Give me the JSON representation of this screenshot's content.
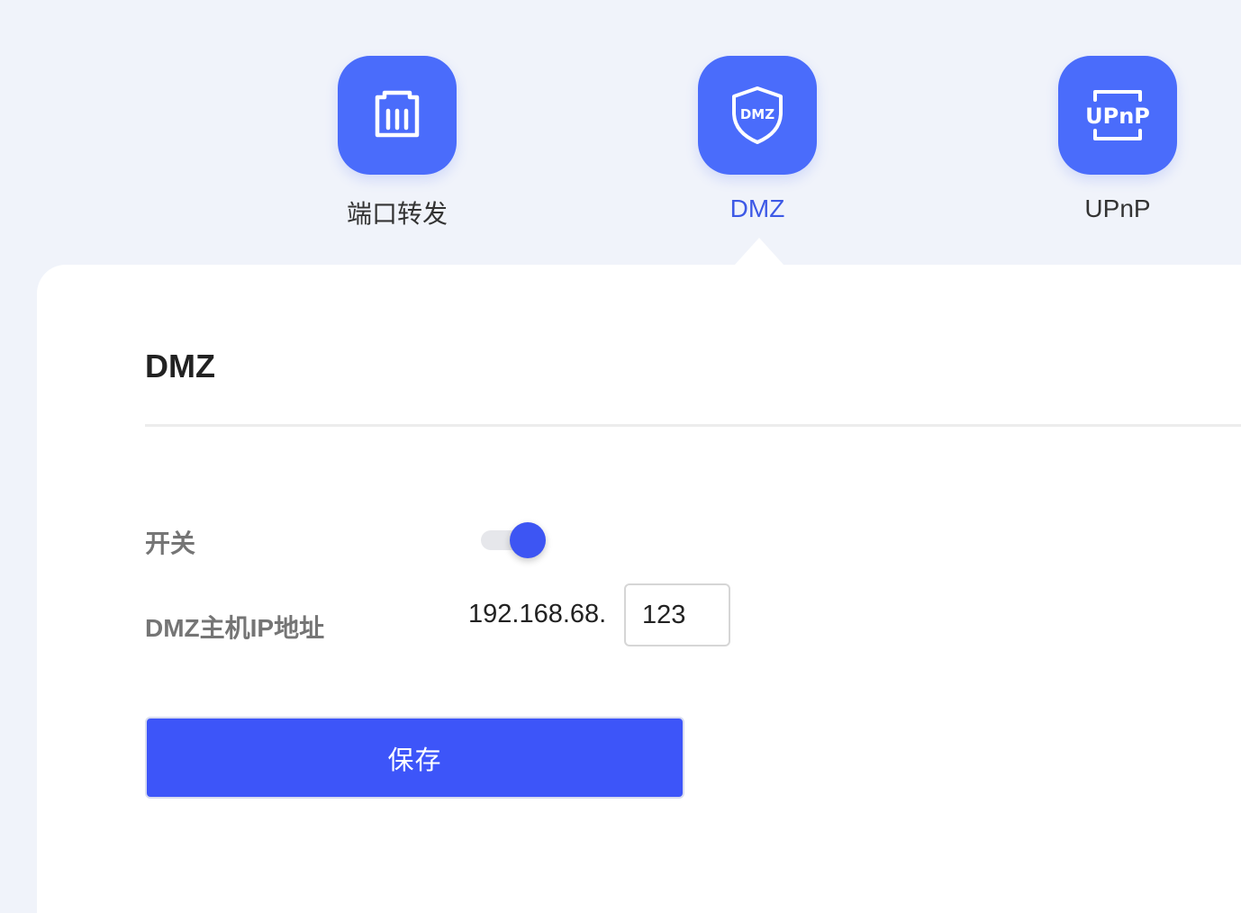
{
  "nav": {
    "items": [
      {
        "label": "端口转发",
        "icon": "ethernet-port-icon",
        "active": false
      },
      {
        "label": "DMZ",
        "icon": "dmz-shield-icon",
        "icon_text": "DMZ",
        "active": true
      },
      {
        "label": "UPnP",
        "icon": "upnp-icon",
        "icon_text": "UPnP",
        "active": false
      }
    ]
  },
  "section": {
    "title": "DMZ"
  },
  "form": {
    "switch_label": "开关",
    "switch_on": true,
    "host_ip_label": "DMZ主机IP地址",
    "ip_prefix": "192.168.68.",
    "ip_last_octet": "123"
  },
  "actions": {
    "save_label": "保存"
  },
  "colors": {
    "accent": "#4a6cfb",
    "active_text": "#3d59e6",
    "button": "#3d55f9",
    "background": "#f0f3fa"
  }
}
